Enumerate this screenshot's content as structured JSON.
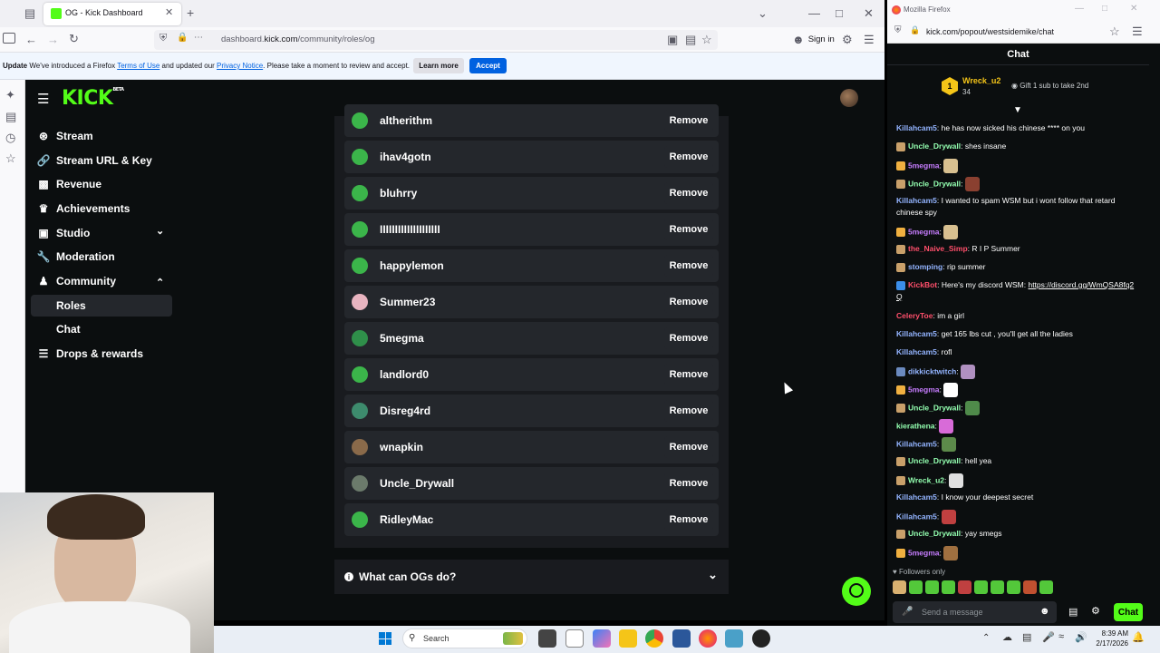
{
  "browser_left": {
    "tab_title": "OG - Kick Dashboard",
    "url_host": "dashboard.",
    "url_domain": "kick.com",
    "url_path": "/community/roles/og",
    "signin_label": "Sign in"
  },
  "notice": {
    "prefix": "Update",
    "text1": " We've introduced a Firefox ",
    "terms": "Terms of Use",
    "text2": " and updated our ",
    "privacy": "Privacy Notice",
    "text3": ". Please take a moment to review and accept.",
    "learn_more": "Learn more",
    "accept": "Accept"
  },
  "kick": {
    "logo_text": "KICK",
    "logo_badge": "BETA"
  },
  "sidebar": {
    "items": [
      {
        "label": "Stream",
        "icon": "broadcast-icon"
      },
      {
        "label": "Stream URL & Key",
        "icon": "link-icon"
      },
      {
        "label": "Revenue",
        "icon": "revenue-icon"
      },
      {
        "label": "Achievements",
        "icon": "trophy-icon"
      },
      {
        "label": "Studio",
        "icon": "studio-icon"
      },
      {
        "label": "Moderation",
        "icon": "wrench-icon"
      },
      {
        "label": "Community",
        "icon": "people-icon"
      },
      {
        "label": "Roles",
        "icon": ""
      },
      {
        "label": "Chat",
        "icon": ""
      },
      {
        "label": "Drops & rewards",
        "icon": "drops-icon"
      }
    ]
  },
  "og_list": {
    "remove_label": "Remove",
    "users": [
      {
        "name": "altherithm",
        "color": "#3bb54a"
      },
      {
        "name": "ihav4gotn",
        "color": "#3bb54a"
      },
      {
        "name": "bluhrry",
        "color": "#3bb54a"
      },
      {
        "name": "IIIIIIIIIIIIIIIIIIII",
        "color": "#3bb54a"
      },
      {
        "name": "happylemon",
        "color": "#3bb54a"
      },
      {
        "name": "Summer23",
        "color": "#e8b4c0"
      },
      {
        "name": "5megma",
        "color": "#2f8f4a"
      },
      {
        "name": "landlord0",
        "color": "#3bb54a"
      },
      {
        "name": "Disreg4rd",
        "color": "#3d8b6d"
      },
      {
        "name": "wnapkin",
        "color": "#8a6a4a"
      },
      {
        "name": "Uncle_Drywall",
        "color": "#6b7a6b"
      },
      {
        "name": "RidleyMac",
        "color": "#3bb54a"
      }
    ],
    "faq_label": "What can OGs do?"
  },
  "browser_right": {
    "title": "Mozilla Firefox",
    "url": "kick.com/popout/westsidemike/chat",
    "chat_title": "Chat"
  },
  "chat": {
    "pinned": {
      "rank": "1",
      "user": "Wreck_u2",
      "count": "34",
      "gift_text": "Gift 1 sub to take 2nd"
    },
    "messages": [
      {
        "user": "Killahcam5",
        "color": "#93b4ff",
        "text": "he has now sicked his chinese **** on you",
        "badge": ""
      },
      {
        "user": "Uncle_Drywall",
        "color": "#93ffb0",
        "text": "shes insane",
        "badge": "#c9a06a"
      },
      {
        "user": "5megma",
        "color": "#c77dff",
        "text": "",
        "badge": "#f0b040",
        "emote": "#d8c090"
      },
      {
        "user": "Uncle_Drywall",
        "color": "#93ffb0",
        "text": "",
        "badge": "#c9a06a",
        "emote": "#8a4030"
      },
      {
        "user": "Killahcam5",
        "color": "#93b4ff",
        "text": "I wanted to spam WSM but i wont follow that retard chinese spy",
        "badge": ""
      },
      {
        "user": "5megma",
        "color": "#c77dff",
        "text": "",
        "badge": "#f0b040",
        "emote": "#d8c090"
      },
      {
        "user": "the_Naive_Simp",
        "color": "#ff4f6b",
        "text": "R I P Summer",
        "badge": "#c9a06a"
      },
      {
        "user": "stomping",
        "color": "#93b4ff",
        "text": "rip summer",
        "badge": "#c9a06a"
      },
      {
        "user": "KickBot",
        "color": "#ff4f6b",
        "text": "Here's my discord WSM: ",
        "link": "https://discord.gg/WmQSA8fq2Q",
        "badge": "#3b8eea"
      },
      {
        "user": "CeleryToe",
        "color": "#ff4f6b",
        "text": "im a girl",
        "badge": ""
      },
      {
        "user": "Killahcam5",
        "color": "#93b4ff",
        "text": "get 165 lbs cut , you'll get all the ladies",
        "badge": ""
      },
      {
        "user": "Killahcam5",
        "color": "#93b4ff",
        "text": "rofl",
        "badge": ""
      },
      {
        "user": "dikkicktwitch",
        "color": "#93b4ff",
        "text": "",
        "badge": "#6b8abf",
        "emote": "#b090c0"
      },
      {
        "user": "5megma",
        "color": "#c77dff",
        "text": "",
        "badge": "#f0b040",
        "emote": "#ffffff"
      },
      {
        "user": "Uncle_Drywall",
        "color": "#93ffb0",
        "text": "",
        "badge": "#c9a06a",
        "emote": "#4f8a4a"
      },
      {
        "user": "kierathena",
        "color": "#93ffb0",
        "text": "",
        "badge": "",
        "emote": "#d86bd8"
      },
      {
        "user": "Killahcam5",
        "color": "#93b4ff",
        "text": "",
        "badge": "",
        "emote": "#5c8a4a"
      },
      {
        "user": "Uncle_Drywall",
        "color": "#93ffb0",
        "text": "hell yea",
        "badge": "#c9a06a"
      },
      {
        "user": "Wreck_u2",
        "color": "#93ffb0",
        "text": "",
        "badge": "#c9a06a",
        "emote": "#e0e0e0"
      },
      {
        "user": "Killahcam5",
        "color": "#93b4ff",
        "text": "I know your deepest secret",
        "badge": ""
      },
      {
        "user": "Killahcam5",
        "color": "#93b4ff",
        "text": "",
        "badge": "",
        "emote": "#c04040"
      },
      {
        "user": "Uncle_Drywall",
        "color": "#93ffb0",
        "text": "yay smegs",
        "badge": "#c9a06a"
      },
      {
        "user": "5megma",
        "color": "#c77dff",
        "text": "",
        "badge": "#f0b040",
        "emote": "#a07040"
      }
    ],
    "followers_only": "Followers only",
    "input_placeholder": "Send a message",
    "send_label": "Chat"
  },
  "taskbar": {
    "search_placeholder": "Search",
    "time": "8:39 AM",
    "date": "2/17/2026"
  },
  "colors": {
    "kick_green": "#53fc18",
    "page_bg": "#0b0e0f",
    "row_bg": "#24272c",
    "card_bg": "#191b1f",
    "firefox_accept": "#0061e0"
  }
}
